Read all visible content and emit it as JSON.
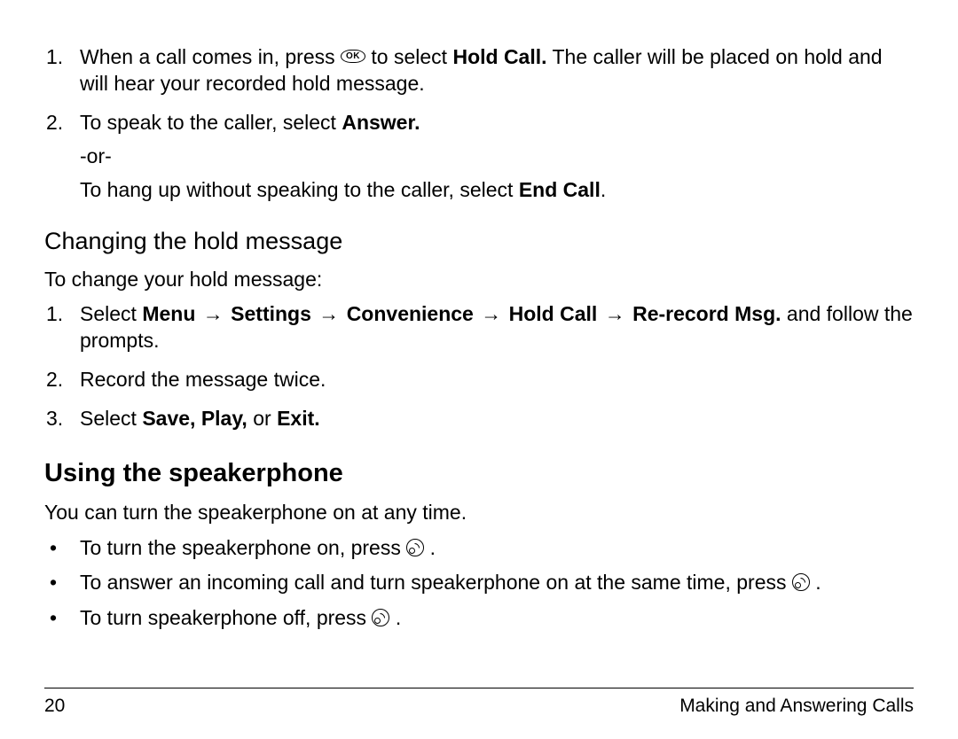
{
  "holdCallSteps": {
    "s1": {
      "num": "1.",
      "pre": "When a call comes in, press ",
      "mid": " to select ",
      "bold1": "Hold Call.",
      "post": " The caller will be placed on hold and will hear your recorded hold message."
    },
    "s2": {
      "num": "2.",
      "line1_pre": "To speak to the caller, select ",
      "line1_bold": "Answer.",
      "or": "-or-",
      "line2_pre": "To hang up without speaking to the caller, select ",
      "line2_bold": "End Call",
      "line2_post": "."
    }
  },
  "changeHold": {
    "heading": "Changing the hold message",
    "intro": "To change your hold message:",
    "s1": {
      "num": "1.",
      "pre": "Select ",
      "menu": "Menu",
      "settings": "Settings",
      "convenience": "Convenience",
      "holdcall": "Hold Call",
      "rerecord": "Re-record Msg.",
      "post": " and follow the prompts."
    },
    "s2": {
      "num": "2.",
      "text": "Record the message twice."
    },
    "s3": {
      "num": "3.",
      "pre": "Select ",
      "saveplay": "Save, Play,",
      "mid": " or ",
      "exit": "Exit."
    }
  },
  "speakerphone": {
    "heading": "Using the speakerphone",
    "intro": "You can turn the speakerphone on at any time.",
    "b1": {
      "pre": "To turn the speakerphone on, press ",
      "post": " ."
    },
    "b2": {
      "pre": "To answer an incoming call and turn speakerphone on at the same time, press ",
      "post": " ."
    },
    "b3": {
      "pre": "To turn speakerphone off, press ",
      "post": " ."
    }
  },
  "footer": {
    "page": "20",
    "section": "Making and Answering Calls"
  },
  "glyphs": {
    "arrow": "→",
    "bullet": "•"
  }
}
